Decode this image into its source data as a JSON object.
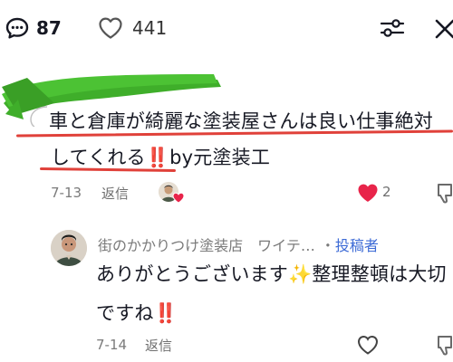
{
  "header": {
    "comment_count": "87",
    "like_count": "441"
  },
  "comment": {
    "line1": "車と倉庫が綺麗な塗装屋さんは良い仕事絶対",
    "line2_text": "してくれる",
    "line2_bang": "‼️",
    "line2_suffix": "by元塗装工",
    "date": "7-13",
    "reply_label": "返信",
    "likes": "2"
  },
  "reply": {
    "name": "街のかかりつけ塗装店　ワイテ…",
    "separator": "・",
    "author_tag": "投稿者",
    "line1_a": "ありがとうございます",
    "line1_sparkle": "✨",
    "line1_b": "整理整頓は大切",
    "line2_text": "ですね",
    "line2_bang": "‼️",
    "date": "7-14",
    "reply_label": "返信"
  },
  "colors": {
    "underline": "#e0413a",
    "heart_liked": "#e8244a",
    "author_tag": "#3d6bd6",
    "redaction": "#3fae2a"
  },
  "icons": [
    "comment-icon",
    "heart-icon",
    "filter-sliders-icon",
    "close-icon",
    "dislike-icon",
    "heart-liked-icon"
  ]
}
